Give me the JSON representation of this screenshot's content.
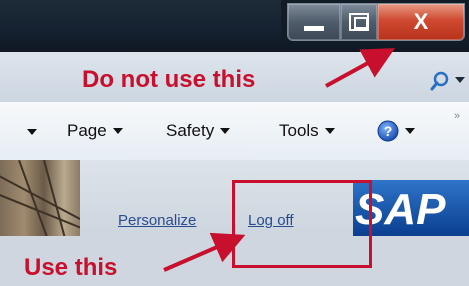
{
  "window_controls": {
    "minimize_icon": "minimize-icon",
    "maximize_icon": "restore-icon",
    "close_label": "X"
  },
  "toolbar": {
    "page_label": "Page",
    "safety_label": "Safety",
    "tools_label": "Tools",
    "help_icon": "help-icon",
    "more_label": "»"
  },
  "page": {
    "personalize_label": "Personalize",
    "logoff_label": "Log off",
    "logo_text": "SAP"
  },
  "annotations": {
    "top_text": "Do not use this",
    "bottom_text": "Use this",
    "color": "#c8102e"
  }
}
